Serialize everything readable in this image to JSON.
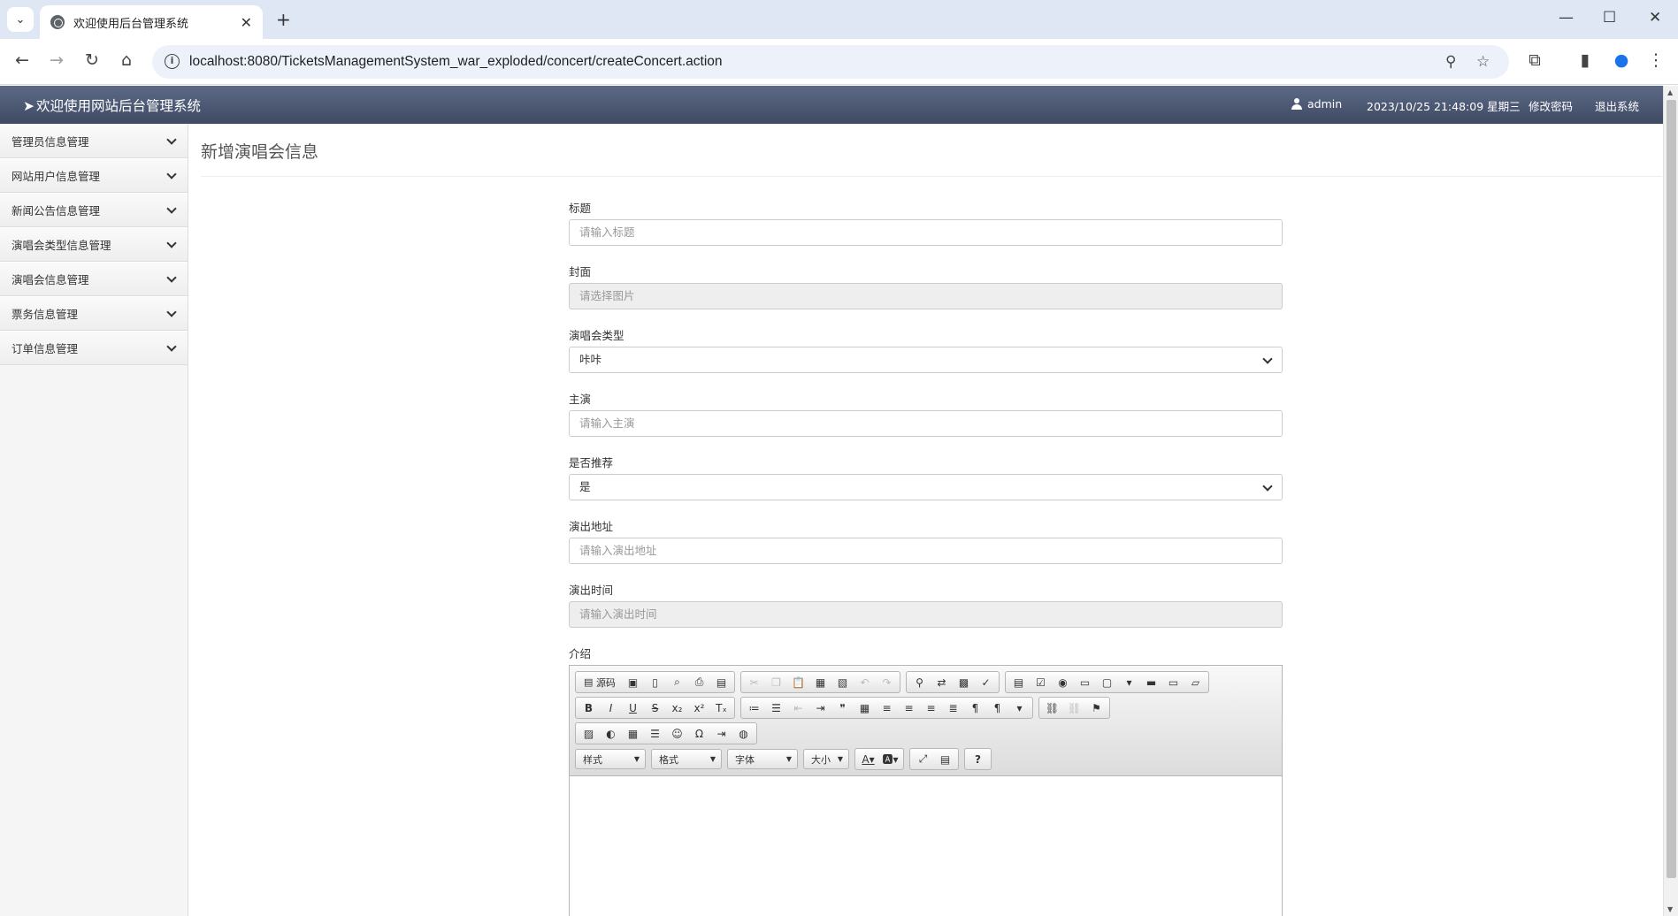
{
  "browser": {
    "tab_title": "欢迎使用后台管理系统",
    "url": "localhost:8080/TicketsManagementSystem_war_exploded/concert/createConcert.action"
  },
  "header": {
    "brand": "欢迎使用网站后台管理系统",
    "user": "admin",
    "datetime": "2023/10/25 21:48:09 星期三",
    "change_password": "修改密码",
    "logout": "退出系统"
  },
  "sidebar": {
    "items": [
      {
        "label": "管理员信息管理"
      },
      {
        "label": "网站用户信息管理"
      },
      {
        "label": "新闻公告信息管理"
      },
      {
        "label": "演唱会类型信息管理"
      },
      {
        "label": "演唱会信息管理"
      },
      {
        "label": "票务信息管理"
      },
      {
        "label": "订单信息管理"
      }
    ]
  },
  "page": {
    "title": "新增演唱会信息"
  },
  "form": {
    "title": {
      "label": "标题",
      "placeholder": "请输入标题"
    },
    "cover": {
      "label": "封面",
      "placeholder": "请选择图片"
    },
    "type": {
      "label": "演唱会类型",
      "value": "咔咔"
    },
    "lead": {
      "label": "主演",
      "placeholder": "请输入主演"
    },
    "recommend": {
      "label": "是否推荐",
      "value": "是"
    },
    "address": {
      "label": "演出地址",
      "placeholder": "请输入演出地址"
    },
    "time": {
      "label": "演出时间",
      "placeholder": "请输入演出时间"
    },
    "intro": {
      "label": "介绍"
    }
  },
  "editor": {
    "source_label": "源码",
    "combo_style": "样式",
    "combo_format": "格式",
    "combo_font": "字体",
    "combo_size": "大小"
  }
}
